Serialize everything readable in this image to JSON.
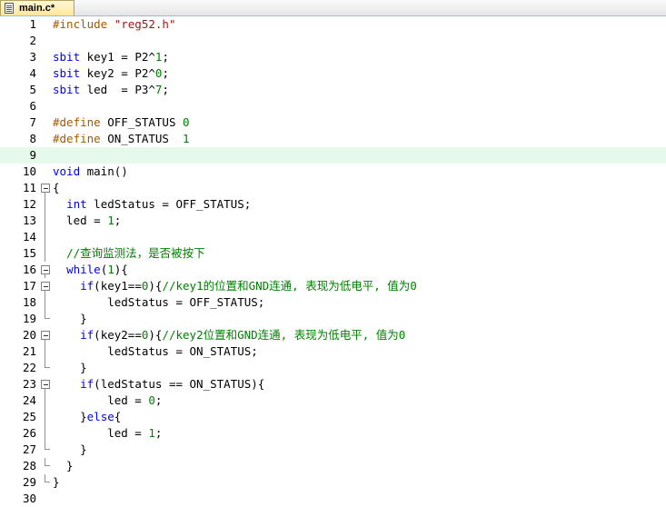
{
  "tab": {
    "label": "main.c*",
    "icon": "c-file-icon"
  },
  "current_line": 9,
  "lines": [
    {
      "n": "1",
      "fold": "none",
      "tokens": [
        [
          "pp",
          "#include "
        ],
        [
          "str",
          "\"reg52.h\""
        ]
      ]
    },
    {
      "n": "2",
      "fold": "none",
      "tokens": []
    },
    {
      "n": "3",
      "fold": "none",
      "tokens": [
        [
          "kw",
          "sbit"
        ],
        [
          "txt",
          " key1 = P2^"
        ],
        [
          "num",
          "1"
        ],
        [
          "txt",
          ";"
        ]
      ]
    },
    {
      "n": "4",
      "fold": "none",
      "tokens": [
        [
          "kw",
          "sbit"
        ],
        [
          "txt",
          " key2 = P2^"
        ],
        [
          "num",
          "0"
        ],
        [
          "txt",
          ";"
        ]
      ]
    },
    {
      "n": "5",
      "fold": "none",
      "tokens": [
        [
          "kw",
          "sbit"
        ],
        [
          "txt",
          " led  = P3^"
        ],
        [
          "num",
          "7"
        ],
        [
          "txt",
          ";"
        ]
      ]
    },
    {
      "n": "6",
      "fold": "none",
      "tokens": []
    },
    {
      "n": "7",
      "fold": "none",
      "tokens": [
        [
          "pp",
          "#define "
        ],
        [
          "txt",
          "OFF_STATUS "
        ],
        [
          "num",
          "0"
        ]
      ]
    },
    {
      "n": "8",
      "fold": "none",
      "tokens": [
        [
          "pp",
          "#define "
        ],
        [
          "txt",
          "ON_STATUS  "
        ],
        [
          "num",
          "1"
        ]
      ]
    },
    {
      "n": "9",
      "fold": "none",
      "tokens": []
    },
    {
      "n": "10",
      "fold": "none",
      "tokens": [
        [
          "kw",
          "void"
        ],
        [
          "txt",
          " main()"
        ]
      ]
    },
    {
      "n": "11",
      "fold": "open",
      "tokens": [
        [
          "txt",
          "{"
        ]
      ]
    },
    {
      "n": "12",
      "fold": "line",
      "tokens": [
        [
          "txt",
          "  "
        ],
        [
          "kw",
          "int"
        ],
        [
          "txt",
          " ledStatus = OFF_STATUS;"
        ]
      ]
    },
    {
      "n": "13",
      "fold": "line",
      "tokens": [
        [
          "txt",
          "  led = "
        ],
        [
          "num",
          "1"
        ],
        [
          "txt",
          ";"
        ]
      ]
    },
    {
      "n": "14",
      "fold": "line",
      "tokens": []
    },
    {
      "n": "15",
      "fold": "line",
      "tokens": [
        [
          "txt",
          "  "
        ],
        [
          "cmt",
          "//查询监测法，是否被按下"
        ]
      ]
    },
    {
      "n": "16",
      "fold": "open",
      "tokens": [
        [
          "txt",
          "  "
        ],
        [
          "kw",
          "while"
        ],
        [
          "txt",
          "("
        ],
        [
          "num",
          "1"
        ],
        [
          "txt",
          "){"
        ]
      ]
    },
    {
      "n": "17",
      "fold": "open",
      "tokens": [
        [
          "txt",
          "    "
        ],
        [
          "kw",
          "if"
        ],
        [
          "txt",
          "(key1=="
        ],
        [
          "num",
          "0"
        ],
        [
          "txt",
          "){"
        ],
        [
          "cmt",
          "//key1的位置和GND连通, 表现为低电平, 值为0"
        ]
      ]
    },
    {
      "n": "18",
      "fold": "line",
      "tokens": [
        [
          "txt",
          "        ledStatus = OFF_STATUS;"
        ]
      ]
    },
    {
      "n": "19",
      "fold": "end",
      "tokens": [
        [
          "txt",
          "    }"
        ]
      ]
    },
    {
      "n": "20",
      "fold": "open",
      "tokens": [
        [
          "txt",
          "    "
        ],
        [
          "kw",
          "if"
        ],
        [
          "txt",
          "(key2=="
        ],
        [
          "num",
          "0"
        ],
        [
          "txt",
          "){"
        ],
        [
          "cmt",
          "//key2位置和GND连通, 表现为低电平, 值为0"
        ]
      ]
    },
    {
      "n": "21",
      "fold": "line",
      "tokens": [
        [
          "txt",
          "        ledStatus = ON_STATUS;"
        ]
      ]
    },
    {
      "n": "22",
      "fold": "end",
      "tokens": [
        [
          "txt",
          "    }"
        ]
      ]
    },
    {
      "n": "23",
      "fold": "open",
      "tokens": [
        [
          "txt",
          "    "
        ],
        [
          "kw",
          "if"
        ],
        [
          "txt",
          "(ledStatus == ON_STATUS){"
        ]
      ]
    },
    {
      "n": "24",
      "fold": "line",
      "tokens": [
        [
          "txt",
          "        led = "
        ],
        [
          "num",
          "0"
        ],
        [
          "txt",
          ";"
        ]
      ]
    },
    {
      "n": "25",
      "fold": "line",
      "tokens": [
        [
          "txt",
          "    }"
        ],
        [
          "kw",
          "else"
        ],
        [
          "txt",
          "{"
        ]
      ]
    },
    {
      "n": "26",
      "fold": "line",
      "tokens": [
        [
          "txt",
          "        led = "
        ],
        [
          "num",
          "1"
        ],
        [
          "txt",
          ";"
        ]
      ]
    },
    {
      "n": "27",
      "fold": "end",
      "tokens": [
        [
          "txt",
          "    }"
        ]
      ]
    },
    {
      "n": "28",
      "fold": "end",
      "tokens": [
        [
          "txt",
          "  }"
        ]
      ]
    },
    {
      "n": "29",
      "fold": "end",
      "tokens": [
        [
          "txt",
          "}"
        ]
      ]
    },
    {
      "n": "30",
      "fold": "none",
      "tokens": []
    }
  ]
}
